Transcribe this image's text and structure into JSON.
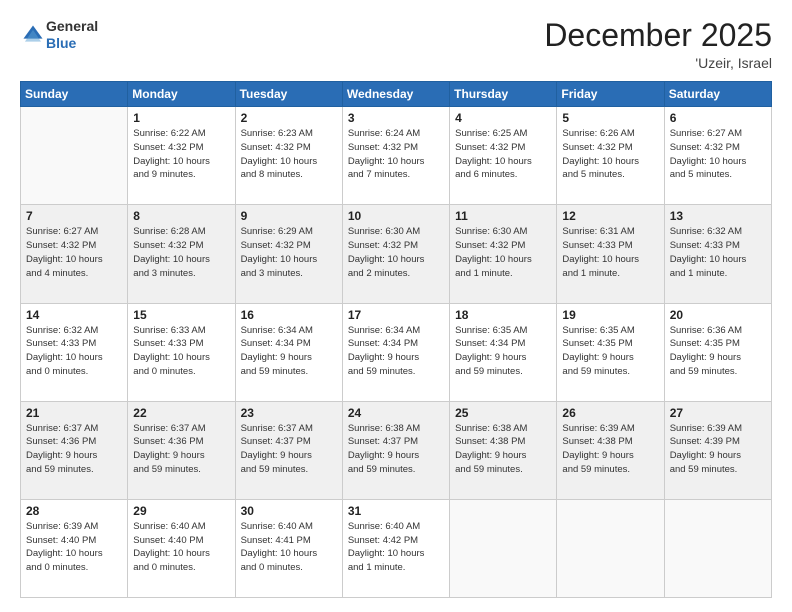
{
  "header": {
    "logo_line1": "General",
    "logo_line2": "Blue",
    "month_year": "December 2025",
    "location": "'Uzeir, Israel"
  },
  "days_of_week": [
    "Sunday",
    "Monday",
    "Tuesday",
    "Wednesday",
    "Thursday",
    "Friday",
    "Saturday"
  ],
  "weeks": [
    [
      {
        "day": "",
        "info": ""
      },
      {
        "day": "1",
        "info": "Sunrise: 6:22 AM\nSunset: 4:32 PM\nDaylight: 10 hours\nand 9 minutes."
      },
      {
        "day": "2",
        "info": "Sunrise: 6:23 AM\nSunset: 4:32 PM\nDaylight: 10 hours\nand 8 minutes."
      },
      {
        "day": "3",
        "info": "Sunrise: 6:24 AM\nSunset: 4:32 PM\nDaylight: 10 hours\nand 7 minutes."
      },
      {
        "day": "4",
        "info": "Sunrise: 6:25 AM\nSunset: 4:32 PM\nDaylight: 10 hours\nand 6 minutes."
      },
      {
        "day": "5",
        "info": "Sunrise: 6:26 AM\nSunset: 4:32 PM\nDaylight: 10 hours\nand 5 minutes."
      },
      {
        "day": "6",
        "info": "Sunrise: 6:27 AM\nSunset: 4:32 PM\nDaylight: 10 hours\nand 5 minutes."
      }
    ],
    [
      {
        "day": "7",
        "info": "Sunrise: 6:27 AM\nSunset: 4:32 PM\nDaylight: 10 hours\nand 4 minutes."
      },
      {
        "day": "8",
        "info": "Sunrise: 6:28 AM\nSunset: 4:32 PM\nDaylight: 10 hours\nand 3 minutes."
      },
      {
        "day": "9",
        "info": "Sunrise: 6:29 AM\nSunset: 4:32 PM\nDaylight: 10 hours\nand 3 minutes."
      },
      {
        "day": "10",
        "info": "Sunrise: 6:30 AM\nSunset: 4:32 PM\nDaylight: 10 hours\nand 2 minutes."
      },
      {
        "day": "11",
        "info": "Sunrise: 6:30 AM\nSunset: 4:32 PM\nDaylight: 10 hours\nand 1 minute."
      },
      {
        "day": "12",
        "info": "Sunrise: 6:31 AM\nSunset: 4:33 PM\nDaylight: 10 hours\nand 1 minute."
      },
      {
        "day": "13",
        "info": "Sunrise: 6:32 AM\nSunset: 4:33 PM\nDaylight: 10 hours\nand 1 minute."
      }
    ],
    [
      {
        "day": "14",
        "info": "Sunrise: 6:32 AM\nSunset: 4:33 PM\nDaylight: 10 hours\nand 0 minutes."
      },
      {
        "day": "15",
        "info": "Sunrise: 6:33 AM\nSunset: 4:33 PM\nDaylight: 10 hours\nand 0 minutes."
      },
      {
        "day": "16",
        "info": "Sunrise: 6:34 AM\nSunset: 4:34 PM\nDaylight: 9 hours\nand 59 minutes."
      },
      {
        "day": "17",
        "info": "Sunrise: 6:34 AM\nSunset: 4:34 PM\nDaylight: 9 hours\nand 59 minutes."
      },
      {
        "day": "18",
        "info": "Sunrise: 6:35 AM\nSunset: 4:34 PM\nDaylight: 9 hours\nand 59 minutes."
      },
      {
        "day": "19",
        "info": "Sunrise: 6:35 AM\nSunset: 4:35 PM\nDaylight: 9 hours\nand 59 minutes."
      },
      {
        "day": "20",
        "info": "Sunrise: 6:36 AM\nSunset: 4:35 PM\nDaylight: 9 hours\nand 59 minutes."
      }
    ],
    [
      {
        "day": "21",
        "info": "Sunrise: 6:37 AM\nSunset: 4:36 PM\nDaylight: 9 hours\nand 59 minutes."
      },
      {
        "day": "22",
        "info": "Sunrise: 6:37 AM\nSunset: 4:36 PM\nDaylight: 9 hours\nand 59 minutes."
      },
      {
        "day": "23",
        "info": "Sunrise: 6:37 AM\nSunset: 4:37 PM\nDaylight: 9 hours\nand 59 minutes."
      },
      {
        "day": "24",
        "info": "Sunrise: 6:38 AM\nSunset: 4:37 PM\nDaylight: 9 hours\nand 59 minutes."
      },
      {
        "day": "25",
        "info": "Sunrise: 6:38 AM\nSunset: 4:38 PM\nDaylight: 9 hours\nand 59 minutes."
      },
      {
        "day": "26",
        "info": "Sunrise: 6:39 AM\nSunset: 4:38 PM\nDaylight: 9 hours\nand 59 minutes."
      },
      {
        "day": "27",
        "info": "Sunrise: 6:39 AM\nSunset: 4:39 PM\nDaylight: 9 hours\nand 59 minutes."
      }
    ],
    [
      {
        "day": "28",
        "info": "Sunrise: 6:39 AM\nSunset: 4:40 PM\nDaylight: 10 hours\nand 0 minutes."
      },
      {
        "day": "29",
        "info": "Sunrise: 6:40 AM\nSunset: 4:40 PM\nDaylight: 10 hours\nand 0 minutes."
      },
      {
        "day": "30",
        "info": "Sunrise: 6:40 AM\nSunset: 4:41 PM\nDaylight: 10 hours\nand 0 minutes."
      },
      {
        "day": "31",
        "info": "Sunrise: 6:40 AM\nSunset: 4:42 PM\nDaylight: 10 hours\nand 1 minute."
      },
      {
        "day": "",
        "info": ""
      },
      {
        "day": "",
        "info": ""
      },
      {
        "day": "",
        "info": ""
      }
    ]
  ],
  "row_shading": [
    false,
    true,
    false,
    true,
    false
  ]
}
